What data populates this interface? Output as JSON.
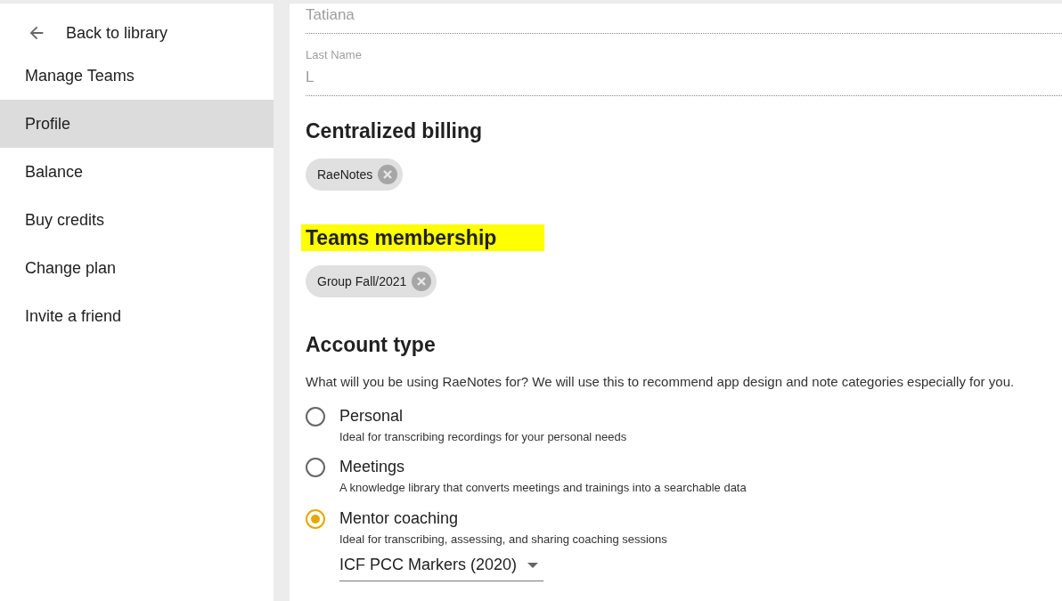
{
  "sidebar": {
    "back_link": {
      "label": "Back to library"
    },
    "items": [
      {
        "label": "Manage Teams",
        "selected": false
      },
      {
        "label": "Profile",
        "selected": true
      },
      {
        "label": "Balance",
        "selected": false
      },
      {
        "label": "Buy credits",
        "selected": false
      },
      {
        "label": "Change plan",
        "selected": false
      },
      {
        "label": "Invite a friend",
        "selected": false
      }
    ]
  },
  "profile": {
    "first_name": {
      "value": "Tatiana"
    },
    "last_name": {
      "label": "Last Name",
      "value": "L"
    },
    "sections": [
      {
        "title": "Centralized billing",
        "highlighted": false,
        "chips": [
          "RaeNotes"
        ]
      },
      {
        "title": "Teams membership",
        "highlighted": true,
        "chips": [
          "Group Fall/2021"
        ]
      }
    ],
    "account_type": {
      "title": "Account type",
      "description": "What will you be using RaeNotes for? We will use this to recommend app design and note categories especially for you.",
      "options": [
        {
          "label": "Personal",
          "hint": "Ideal for transcribing recordings for your personal needs",
          "selected": false
        },
        {
          "label": "Meetings",
          "hint": "A knowledge library that converts meetings and trainings into a searchable data",
          "selected": false
        },
        {
          "label": "Mentor coaching",
          "hint": "Ideal for transcribing, assessing, and sharing coaching sessions",
          "selected": true,
          "select": {
            "value": "ICF PCC Markers (2020)"
          }
        }
      ]
    }
  }
}
